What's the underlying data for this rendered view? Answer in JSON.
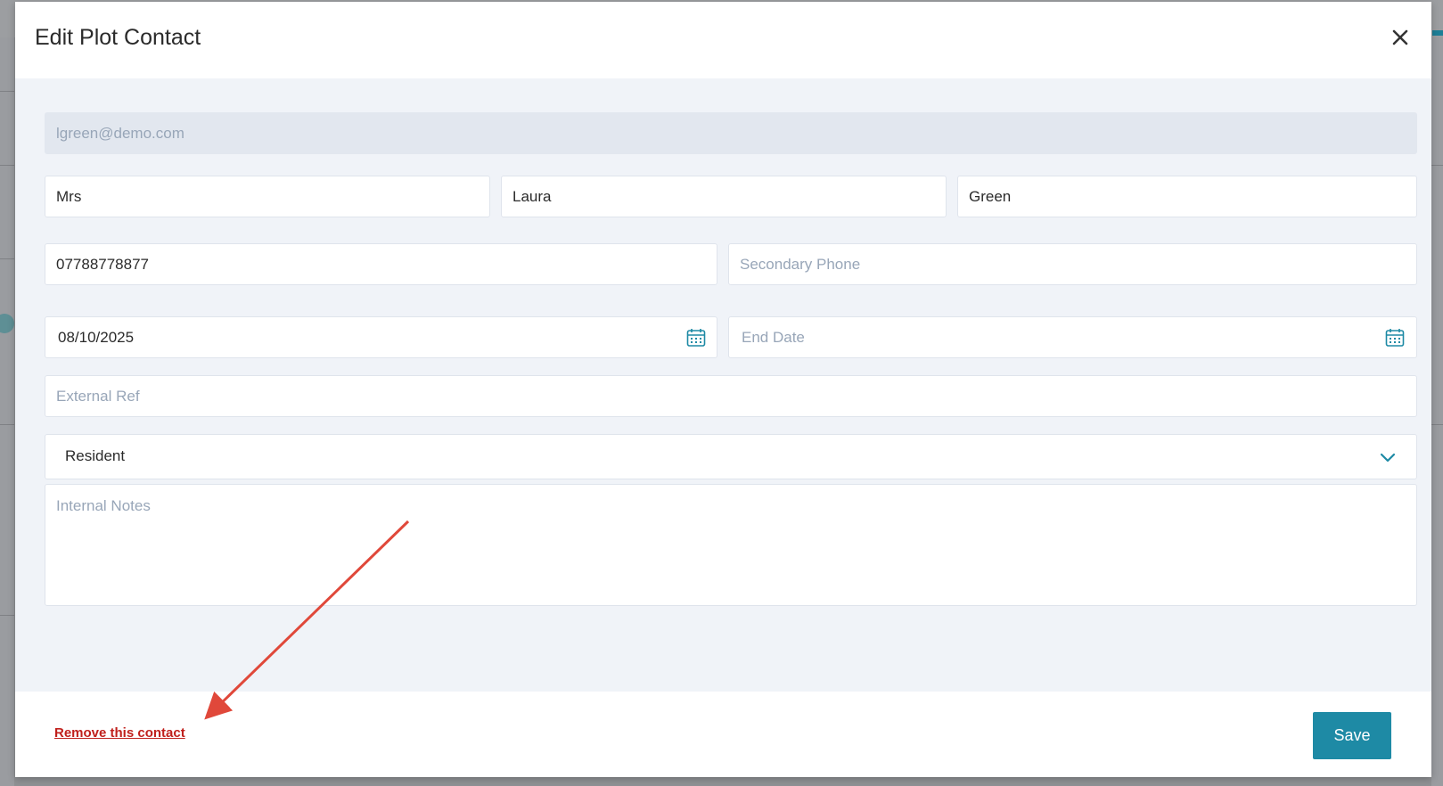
{
  "modal": {
    "title": "Edit Plot Contact",
    "close_icon": "close-icon"
  },
  "form": {
    "email": {
      "value": "",
      "placeholder": "lgreen@demo.com"
    },
    "title": {
      "value": "Mrs",
      "placeholder": ""
    },
    "first_name": {
      "value": "Laura",
      "placeholder": ""
    },
    "last_name": {
      "value": "Green",
      "placeholder": ""
    },
    "primary_phone": {
      "value": "07788778877",
      "placeholder": ""
    },
    "secondary_phone": {
      "value": "",
      "placeholder": "Secondary Phone"
    },
    "start_date": {
      "value": "08/10/2025",
      "placeholder": ""
    },
    "end_date": {
      "value": "",
      "placeholder": "End Date"
    },
    "external_ref": {
      "value": "",
      "placeholder": "External Ref"
    },
    "contact_type": {
      "selected": "Resident",
      "icon": "chevron-down-icon"
    },
    "internal_notes": {
      "value": "",
      "placeholder": "Internal Notes"
    },
    "calendar_icon": "calendar-icon"
  },
  "footer": {
    "remove_label": "Remove this contact",
    "save_label": "Save"
  },
  "colors": {
    "accent": "#1e8aa5",
    "danger": "#c0201c",
    "annotation": "#e0483a",
    "body_bg": "#f0f3f8"
  }
}
